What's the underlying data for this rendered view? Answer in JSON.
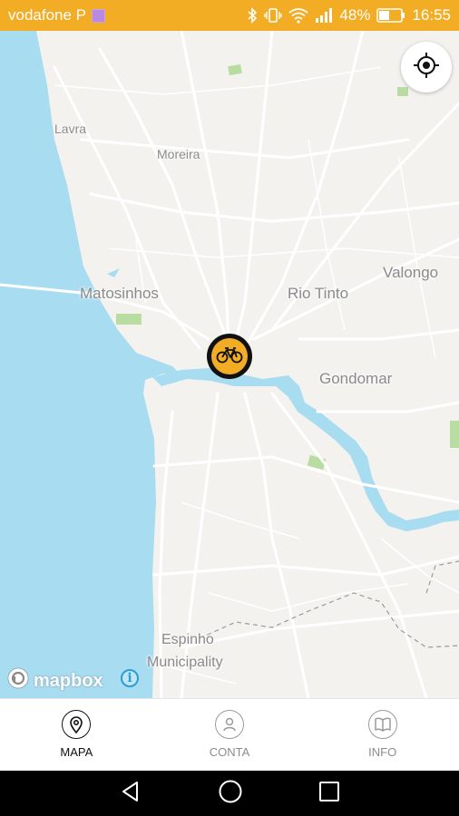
{
  "status_bar": {
    "carrier": "vodafone P",
    "battery_percent": "48%",
    "time": "16:55",
    "icons": [
      "bluetooth-icon",
      "vibrate-icon",
      "wifi-icon",
      "signal-icon",
      "battery-icon"
    ]
  },
  "map": {
    "places": {
      "lavra": "Lavra",
      "moreira": "Moreira",
      "matosinhos": "Matosinhos",
      "rio_tinto": "Rio Tinto",
      "valongo": "Valongo",
      "gondomar": "Gondomar",
      "espinho": "Espinho",
      "municipality": "Municipality"
    },
    "attribution": {
      "logo_text": "mapbox",
      "info_glyph": "i"
    },
    "marker_icon": "bicycle-icon",
    "locate_icon": "locate-crosshair-icon",
    "colors": {
      "water": "#a8dcf0",
      "land": "#f3f2ef",
      "park": "#b8dca2",
      "accent": "#f2ad24"
    }
  },
  "bottom_nav": {
    "items": [
      {
        "label": "MAPA",
        "icon": "map-pin-icon",
        "active": true
      },
      {
        "label": "CONTA",
        "icon": "user-icon",
        "active": false
      },
      {
        "label": "INFO",
        "icon": "book-icon",
        "active": false
      }
    ]
  },
  "system_nav": {
    "icons": [
      "back-icon",
      "home-icon",
      "recents-icon"
    ]
  }
}
